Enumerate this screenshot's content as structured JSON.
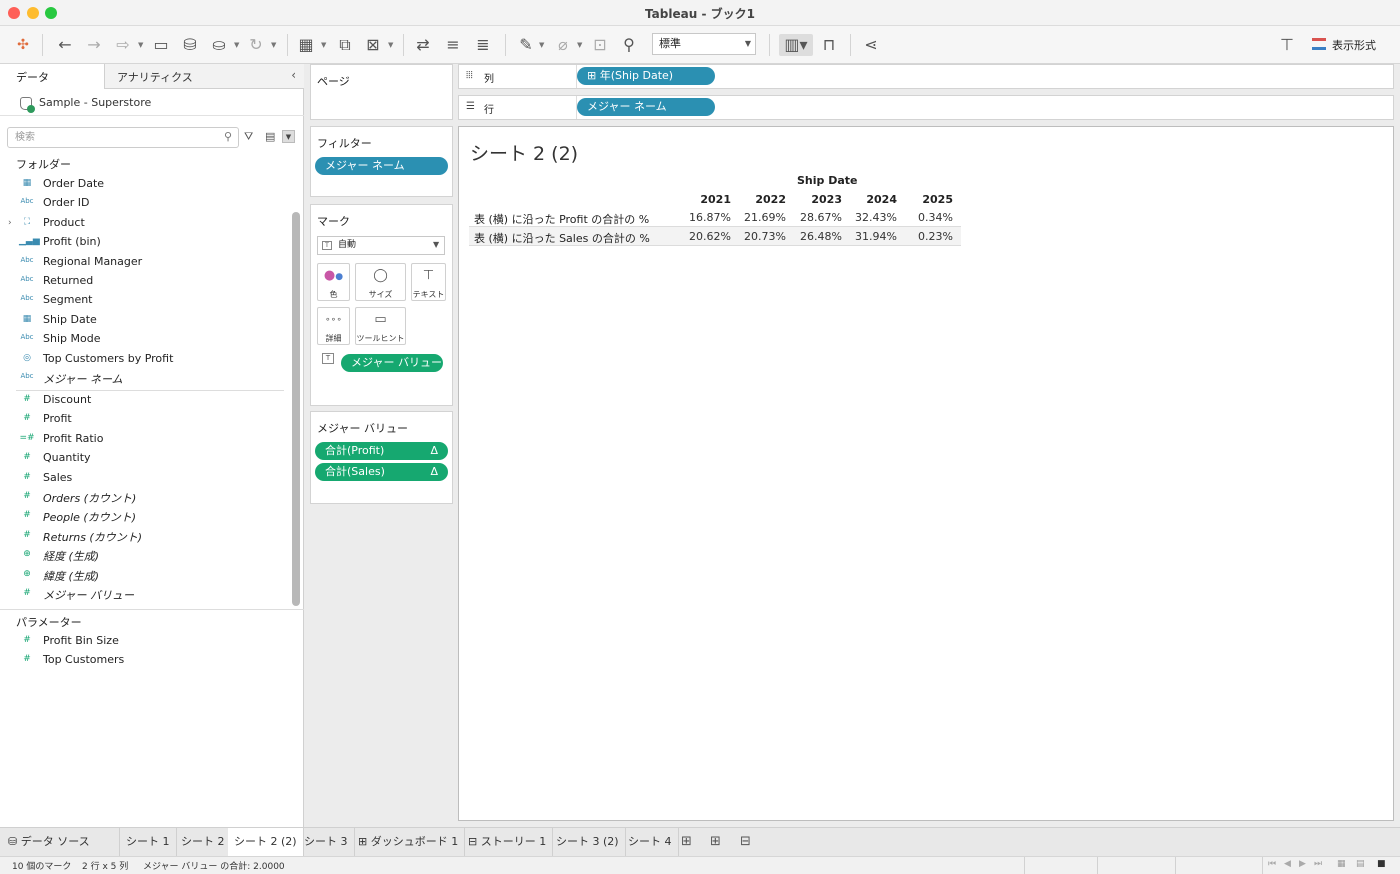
{
  "window": {
    "title": "Tableau - ブック1"
  },
  "toolbar": {
    "fit_value": "標準",
    "show_me_label": "表示形式"
  },
  "data_pane": {
    "tabs": [
      "データ",
      "アナリティクス"
    ],
    "datasource": "Sample - Superstore",
    "search_placeholder": "検索",
    "folders_label": "フォルダー",
    "dimensions": [
      {
        "icon": "calendar-icon",
        "label": "Order Date"
      },
      {
        "icon": "abc-icon",
        "label": "Order ID"
      },
      {
        "icon": "hierarchy-icon",
        "label": "Product"
      },
      {
        "icon": "bin-icon",
        "label": "Profit (bin)"
      },
      {
        "icon": "abc-icon",
        "label": "Regional Manager"
      },
      {
        "icon": "abc-icon",
        "label": "Returned"
      },
      {
        "icon": "abc-icon",
        "label": "Segment"
      },
      {
        "icon": "calendar-icon",
        "label": "Ship Date"
      },
      {
        "icon": "abc-icon",
        "label": "Ship Mode"
      },
      {
        "icon": "set-icon",
        "label": "Top Customers by Profit"
      },
      {
        "icon": "abc-icon",
        "label": "メジャー ネーム"
      }
    ],
    "measures": [
      {
        "icon": "hash-icon",
        "label": "Discount"
      },
      {
        "icon": "hash-icon",
        "label": "Profit"
      },
      {
        "icon": "calc-hash-icon",
        "label": "Profit Ratio"
      },
      {
        "icon": "hash-icon",
        "label": "Quantity"
      },
      {
        "icon": "hash-icon",
        "label": "Sales"
      },
      {
        "icon": "hash-icon",
        "label": "Orders (カウント)"
      },
      {
        "icon": "hash-icon",
        "label": "People (カウント)"
      },
      {
        "icon": "hash-icon",
        "label": "Returns (カウント)"
      },
      {
        "icon": "globe-icon",
        "label": "経度 (生成)"
      },
      {
        "icon": "globe-icon",
        "label": "緯度 (生成)"
      },
      {
        "icon": "hash-icon",
        "label": "メジャー バリュー"
      }
    ],
    "parameters_label": "パラメーター",
    "parameters": [
      {
        "icon": "hash-icon",
        "label": "Profit Bin Size"
      },
      {
        "icon": "hash-icon",
        "label": "Top Customers"
      }
    ]
  },
  "shelves": {
    "pages_label": "ページ",
    "filters_label": "フィルター",
    "filter_pill": "メジャー ネーム",
    "marks_label": "マーク",
    "mark_type": "自動",
    "mark_buttons": [
      "色",
      "サイズ",
      "テキスト",
      "詳細",
      "ツールヒント"
    ],
    "text_pill": "メジャー バリュー",
    "measure_values_label": "メジャー バリュー",
    "measure_value_pills": [
      "合計(Profit)",
      "合計(Sales)"
    ],
    "delta_symbol": "Δ",
    "columns_label": "列",
    "columns_pill": "年(Ship Date)",
    "rows_label": "行",
    "rows_pill": "メジャー ネーム"
  },
  "view": {
    "sheet_title": "シート 2 (2)",
    "column_header": "Ship Date",
    "years": [
      "2021",
      "2022",
      "2023",
      "2024",
      "2025"
    ],
    "rows": [
      {
        "label": "表 (横) に沿った Profit の合計の %",
        "values": [
          "16.87%",
          "21.69%",
          "28.67%",
          "32.43%",
          "0.34%"
        ]
      },
      {
        "label": "表 (横) に沿った Sales の合計の %",
        "values": [
          "20.62%",
          "20.73%",
          "26.48%",
          "31.94%",
          "0.23%"
        ]
      }
    ]
  },
  "sheet_tabs": [
    "データ ソース",
    "シート 1",
    "シート 2",
    "シート 2 (2)",
    "シート 3",
    "ダッシュボード 1",
    "ストーリー 1",
    "シート 3 (2)",
    "シート 4"
  ],
  "status": {
    "marks": "10 個のマーク",
    "dims": "2 行 x 5 列",
    "sum": "メジャー バリュー の合計: 2.0000"
  }
}
